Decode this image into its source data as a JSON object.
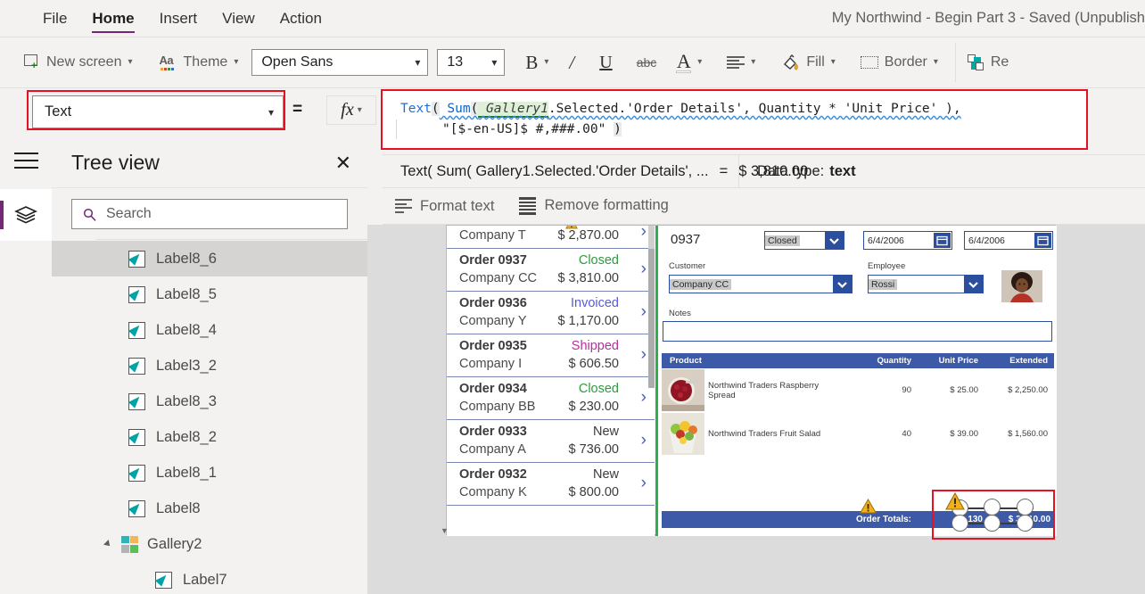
{
  "menu": {
    "items": [
      {
        "label": "File",
        "active": false
      },
      {
        "label": "Home",
        "active": true
      },
      {
        "label": "Insert",
        "active": false
      },
      {
        "label": "View",
        "active": false
      },
      {
        "label": "Action",
        "active": false
      }
    ],
    "app_title": "My Northwind - Begin Part 3 - Saved (Unpublish"
  },
  "ribbon": {
    "new_screen": "New screen",
    "theme": "Theme",
    "font_family": "Open Sans",
    "font_size": "13",
    "bold": "B",
    "italic": "/",
    "underline": "U",
    "strikethrough": "abc",
    "font_color": "A",
    "align": "align-icon",
    "fill": "Fill",
    "border": "Border",
    "reorder": "Re"
  },
  "formula": {
    "property": "Text",
    "equals": "=",
    "fx": "fx",
    "line1_fn1": "Text",
    "line1_p1": "(",
    "line1_fn2": " Sum",
    "line1_p2": "(",
    "line1_gallery": " Gallery1",
    "line1_rest": ".Selected.'Order Details', Quantity * 'Unit Price' ),",
    "line2_str": "\"[$-en-US]$ #,###.00\" ",
    "line2_close": ")"
  },
  "result": {
    "expression": "Text( Sum( Gallery1.Selected.'Order Details', ...",
    "equals": "=",
    "value": "$ 3,810.00",
    "datatype_label": "Data type:",
    "datatype_value": "text"
  },
  "format_strip": {
    "format_text": "Format text",
    "remove_formatting": "Remove formatting"
  },
  "treeview": {
    "title": "Tree view",
    "close": "✕",
    "search_placeholder": "Search",
    "items": [
      {
        "label": "Label8_6",
        "icon": "label-icon",
        "type": "label",
        "selected": true,
        "indent": 0
      },
      {
        "label": "Label8_5",
        "icon": "label-icon",
        "type": "label",
        "selected": false,
        "indent": 0
      },
      {
        "label": "Label8_4",
        "icon": "label-icon",
        "type": "label",
        "selected": false,
        "indent": 0
      },
      {
        "label": "Label3_2",
        "icon": "label-icon",
        "type": "label",
        "selected": false,
        "indent": 0
      },
      {
        "label": "Label8_3",
        "icon": "label-icon",
        "type": "label",
        "selected": false,
        "indent": 0
      },
      {
        "label": "Label8_2",
        "icon": "label-icon",
        "type": "label",
        "selected": false,
        "indent": 0
      },
      {
        "label": "Label8_1",
        "icon": "label-icon",
        "type": "label",
        "selected": false,
        "indent": 0
      },
      {
        "label": "Label8",
        "icon": "label-icon",
        "type": "label",
        "selected": false,
        "indent": 0
      },
      {
        "label": "Gallery2",
        "icon": "gallery-icon",
        "type": "gallery",
        "selected": false,
        "indent": 0
      },
      {
        "label": "Label7",
        "icon": "label-icon",
        "type": "label",
        "selected": false,
        "indent": 1
      }
    ]
  },
  "canvas": {
    "orders_gallery": [
      {
        "order": "",
        "company": "Company T",
        "status": "",
        "amount": "$ 2,870.00",
        "status_color": "#3b3b3b",
        "partial": true,
        "warn": true
      },
      {
        "order": "Order 0937",
        "company": "Company CC",
        "status": "Closed",
        "amount": "$ 3,810.00",
        "status_color": "#2e9b3e",
        "partial": false,
        "warn": false
      },
      {
        "order": "Order 0936",
        "company": "Company Y",
        "status": "Invoiced",
        "amount": "$ 1,170.00",
        "status_color": "#5b5bd6",
        "partial": false,
        "warn": false
      },
      {
        "order": "Order 0935",
        "company": "Company I",
        "status": "Shipped",
        "amount": "$ 606.50",
        "status_color": "#b4319b",
        "partial": false,
        "warn": false
      },
      {
        "order": "Order 0934",
        "company": "Company BB",
        "status": "Closed",
        "amount": "$ 230.00",
        "status_color": "#2e9b3e",
        "partial": false,
        "warn": false
      },
      {
        "order": "Order 0933",
        "company": "Company A",
        "status": "New",
        "amount": "$ 736.00",
        "status_color": "#3b3b3b",
        "partial": false,
        "warn": false
      },
      {
        "order": "Order 0932",
        "company": "Company K",
        "status": "New",
        "amount": "$ 800.00",
        "status_color": "#3b3b3b",
        "partial": false,
        "warn": false
      }
    ],
    "detail": {
      "order_number": "0937",
      "status": "Closed",
      "date1": "6/4/2006",
      "date2": "6/4/2006",
      "customer_label": "Customer",
      "customer_value": "Company CC",
      "employee_label": "Employee",
      "employee_value": "Rossi",
      "notes_label": "Notes",
      "notes_value": ""
    },
    "products_table": {
      "headers": [
        "Product",
        "Quantity",
        "Unit Price",
        "Extended"
      ],
      "rows": [
        {
          "product": "Northwind Traders Raspberry Spread",
          "quantity": "90",
          "unit_price": "$ 25.00",
          "extended": "$ 2,250.00",
          "thumb": "raspberry-spread-thumb"
        },
        {
          "product": "Northwind Traders Fruit Salad",
          "quantity": "40",
          "unit_price": "$ 39.00",
          "extended": "$ 1,560.00",
          "thumb": "fruit-salad-thumb"
        }
      ],
      "totals": {
        "label": "Order Totals:",
        "quantity": "130",
        "extended": "$ 3,810.00"
      }
    }
  },
  "colors": {
    "accent_purple": "#742774",
    "highlight_red": "#e81123",
    "form_blue": "#3c5aa8",
    "control_blue": "#2b4f9e",
    "green_border": "#2eae4e",
    "status_closed": "#2e9b3e",
    "status_invoiced": "#5b5bd6",
    "status_shipped": "#b4319b",
    "chrome_gray": "#f3f2f1"
  }
}
